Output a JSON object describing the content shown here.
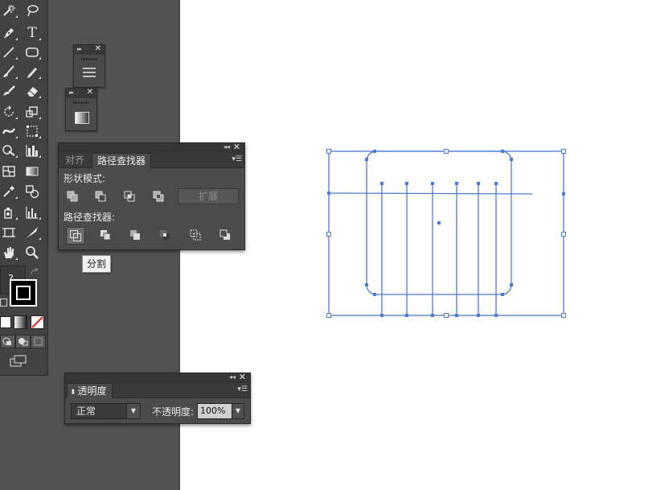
{
  "tools": {
    "help_glyph": "?",
    "type_glyph": "T",
    "items": [
      "magic-wand",
      "lasso",
      "pen",
      "type",
      "line-segment",
      "rounded-rectangle",
      "paintbrush",
      "pencil",
      "blob-brush",
      "eraser",
      "rotate",
      "scale",
      "width",
      "free-transform",
      "shape-builder",
      "graph",
      "mesh",
      "gradient",
      "eyedropper",
      "blend",
      "symbol-sprayer",
      "column-graph",
      "artboard",
      "slice",
      "hand",
      "zoom"
    ]
  },
  "colors": {
    "selection_blue": "#4d79d1",
    "panel_bg": "#4b4b4b",
    "workspace_bg": "#535353",
    "tab_bar_bg": "#3a3a3a",
    "pressed_button": "#6a6a6a"
  },
  "pathfinder_panel": {
    "tab_align": "对齐",
    "tab_pathfinder": "路径查找器",
    "shape_modes_label": "形状模式:",
    "expand_label": "扩展",
    "pathfinders_label": "路径查找器:",
    "shape_modes": [
      "unite",
      "minus-front",
      "intersect",
      "exclude"
    ],
    "pathfinders": [
      "divide",
      "trim",
      "merge",
      "crop",
      "outline",
      "minus-back"
    ]
  },
  "tooltip": {
    "text": "分割"
  },
  "transparency_panel": {
    "tab_label": "透明度",
    "blend_mode": "正常",
    "opacity_label": "不透明度:",
    "opacity_value": "100%"
  }
}
